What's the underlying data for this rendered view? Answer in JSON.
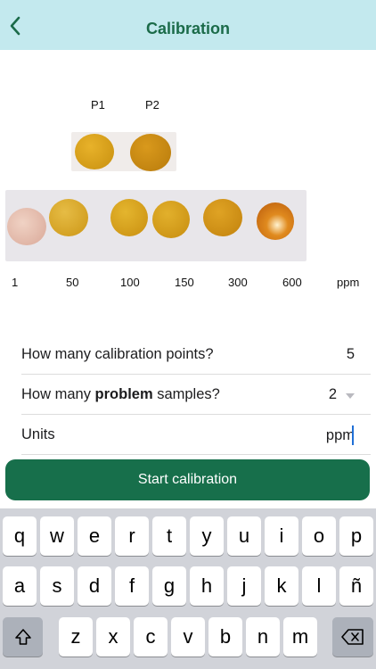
{
  "header": {
    "title": "Calibration",
    "back_icon": "chevron-left-icon",
    "background": "#c3e9ee",
    "accent": "#1b6b49"
  },
  "photo": {
    "problem_labels": [
      "P1",
      "P2"
    ],
    "problem_colors": [
      "#d9a11a",
      "#c98c12"
    ],
    "standard_colors": [
      "#e3b8aa",
      "#d8aa2c",
      "#d6a419",
      "#d3a01a",
      "#cf9418",
      "#cc6a14"
    ],
    "ppm_ticks": [
      "1",
      "50",
      "100",
      "150",
      "300",
      "600"
    ],
    "unit_label": "ppm"
  },
  "form": {
    "calibration_points_question": "How many calibration points?",
    "calibration_points_value": "5",
    "problem_question_prefix": "How many ",
    "problem_question_bold": "problem",
    "problem_question_suffix": " samples?",
    "problem_samples_value": "2",
    "units_label": "Units",
    "units_value": "ppm"
  },
  "actions": {
    "start_label": "Start calibration",
    "color": "#176f4b"
  },
  "keyboard": {
    "row1": [
      "q",
      "w",
      "e",
      "r",
      "t",
      "y",
      "u",
      "i",
      "o",
      "p"
    ],
    "row2": [
      "a",
      "s",
      "d",
      "f",
      "g",
      "h",
      "j",
      "k",
      "l",
      "ñ"
    ],
    "row3": [
      "z",
      "x",
      "c",
      "v",
      "b",
      "n",
      "m"
    ],
    "shift_icon": "shift-icon",
    "delete_icon": "delete-icon"
  }
}
